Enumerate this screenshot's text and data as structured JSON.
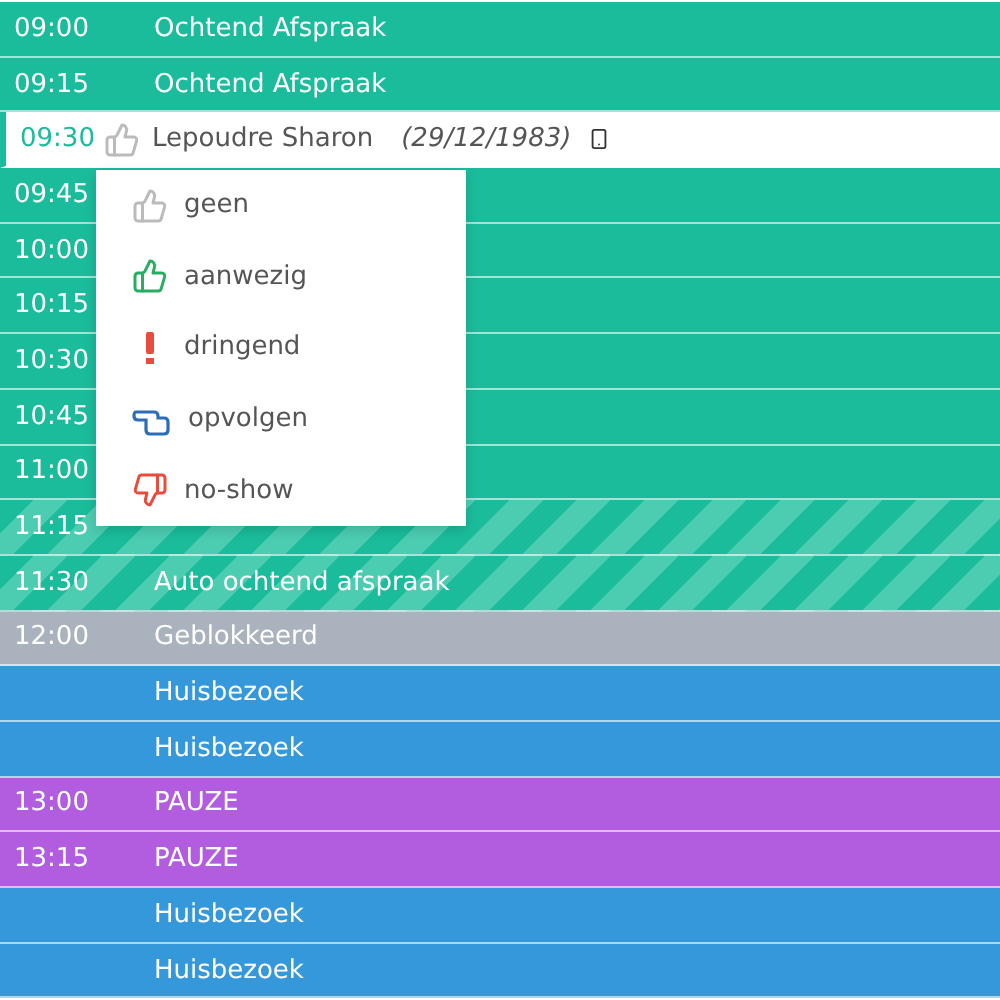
{
  "rows": [
    {
      "time": "09:00",
      "title": "Ochtend Afspraak",
      "kind": "appointment"
    },
    {
      "time": "09:15",
      "title": "Ochtend Afspraak",
      "kind": "appointment"
    },
    {
      "time": "09:30",
      "title": "Lepoudre Sharon",
      "birthdate": "(29/12/1983)",
      "kind": "patient",
      "selected": true
    },
    {
      "time": "09:45",
      "kind": "appointment"
    },
    {
      "time": "10:00",
      "kind": "appointment"
    },
    {
      "time": "10:15",
      "kind": "appointment"
    },
    {
      "time": "10:30",
      "kind": "appointment"
    },
    {
      "time": "10:45",
      "kind": "appointment"
    },
    {
      "time": "11:00",
      "kind": "appointment"
    },
    {
      "time": "11:15",
      "kind": "striped"
    },
    {
      "time": "11:30",
      "title": "Auto ochtend afspraak",
      "kind": "striped"
    },
    {
      "time": "12:00",
      "title": "Geblokkeerd",
      "kind": "blocked"
    },
    {
      "title": "Huisbezoek",
      "kind": "visit"
    },
    {
      "title": "Huisbezoek",
      "kind": "visit"
    },
    {
      "time": "13:00",
      "title": "PAUZE",
      "kind": "pause"
    },
    {
      "time": "13:15",
      "title": "PAUZE",
      "kind": "pause"
    },
    {
      "title": "Huisbezoek",
      "kind": "visit"
    },
    {
      "title": "Huisbezoek",
      "kind": "visit"
    }
  ],
  "status_menu": [
    {
      "label": "geen",
      "kind": "none"
    },
    {
      "label": "aanwezig",
      "kind": "present"
    },
    {
      "label": "dringend",
      "kind": "urgent"
    },
    {
      "label": "opvolgen",
      "kind": "follow"
    },
    {
      "label": "no-show",
      "kind": "noshow"
    }
  ]
}
